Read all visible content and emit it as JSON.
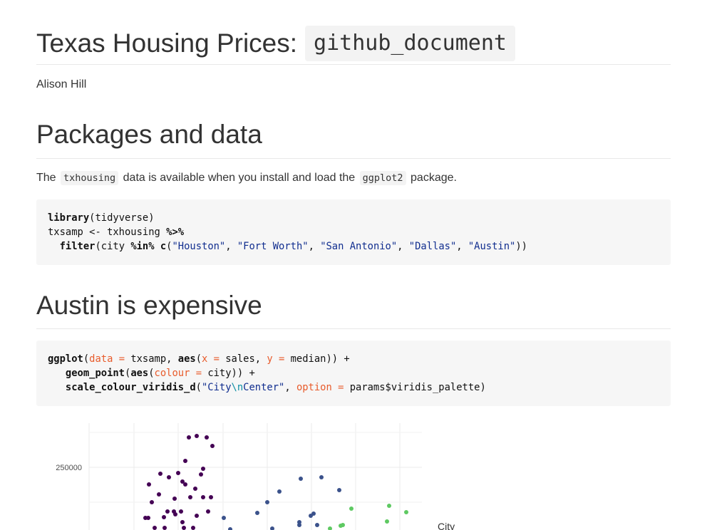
{
  "doc": {
    "title_text": "Texas Housing Prices:",
    "title_code": "github_document",
    "author": "Alison Hill"
  },
  "section1": {
    "heading": "Packages and data",
    "para_parts": [
      "The",
      "txhousing",
      "data is available when you install and load the",
      "ggplot2",
      "package."
    ],
    "code": {
      "line1": [
        "library",
        "(tidyverse)"
      ],
      "line2": [
        "txsamp <- txhousing ",
        "%>%"
      ],
      "line3": [
        "  ",
        "filter",
        "(city ",
        "%in%",
        " ",
        "c",
        "(",
        "\"Houston\"",
        ", ",
        "\"Fort Worth\"",
        ", ",
        "\"San Antonio\"",
        ", ",
        "\"Dallas\"",
        ", ",
        "\"Austin\"",
        "))"
      ]
    }
  },
  "section2": {
    "heading": "Austin is expensive",
    "code": {
      "line1": [
        "ggplot",
        "(",
        "data = ",
        "txsamp, ",
        "aes",
        "(",
        "x = ",
        "sales, ",
        "y = ",
        "median)) +"
      ],
      "line2": [
        "   ",
        "geom_point",
        "(",
        "aes",
        "(",
        "colour = ",
        "city)) +"
      ],
      "line3": [
        "   ",
        "scale_colour_viridis_d",
        "(",
        "\"City",
        "\\n",
        "Center\"",
        ", ",
        "option = ",
        "params$viridis_palette)"
      ]
    }
  },
  "chart_data": {
    "type": "scatter",
    "y_tick_labels": [
      "250000"
    ],
    "legend_title": "City",
    "legend_placement": "right",
    "grid": true,
    "series": [
      {
        "color": "#440154",
        "points": [
          [
            265,
            614
          ],
          [
            276,
            612
          ],
          [
            290,
            614
          ],
          [
            298,
            626
          ],
          [
            260,
            647
          ],
          [
            285,
            658
          ],
          [
            225,
            665
          ],
          [
            250,
            664
          ],
          [
            282,
            666
          ],
          [
            237,
            670
          ],
          [
            256,
            676
          ],
          [
            260,
            680
          ],
          [
            209,
            680
          ],
          [
            274,
            686
          ],
          [
            223,
            694
          ],
          [
            267,
            698
          ],
          [
            285,
            698
          ],
          [
            296,
            698
          ],
          [
            245,
            700
          ],
          [
            213,
            705
          ],
          [
            235,
            718
          ],
          [
            244,
            718
          ],
          [
            254,
            718
          ],
          [
            292,
            718
          ],
          [
            204,
            727
          ],
          [
            208,
            727
          ],
          [
            230,
            726
          ],
          [
            246,
            722
          ],
          [
            276,
            724
          ],
          [
            256,
            733
          ],
          [
            217,
            741
          ],
          [
            231,
            741
          ],
          [
            258,
            741
          ],
          [
            271,
            741
          ]
        ]
      },
      {
        "color": "#3b528b",
        "points": [
          [
            422,
            672
          ],
          [
            451,
            670
          ],
          [
            476,
            688
          ],
          [
            392,
            690
          ],
          [
            375,
            705
          ],
          [
            361,
            720
          ],
          [
            314,
            727
          ],
          [
            440,
            721
          ],
          [
            436,
            724
          ],
          [
            420,
            733
          ],
          [
            420,
            737
          ],
          [
            445,
            737
          ],
          [
            382,
            742
          ],
          [
            323,
            743
          ]
        ]
      },
      {
        "color": "#5ec962",
        "points": [
          [
            546,
            710
          ],
          [
            570,
            719
          ],
          [
            493,
            714
          ],
          [
            543,
            732
          ],
          [
            478,
            738
          ],
          [
            481,
            737
          ],
          [
            463,
            742
          ]
        ]
      }
    ]
  }
}
